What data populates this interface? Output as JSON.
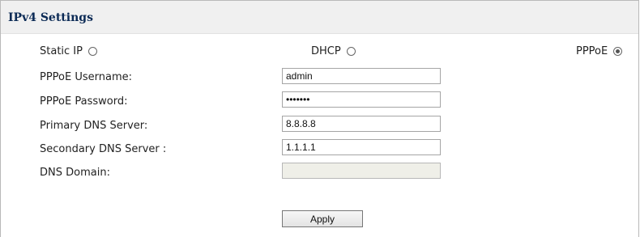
{
  "section": {
    "title": "IPv4 Settings"
  },
  "mode": {
    "options": [
      {
        "label": "Static IP",
        "checked": false
      },
      {
        "label": "DHCP",
        "checked": false
      },
      {
        "label": "PPPoE",
        "checked": true
      }
    ]
  },
  "fields": {
    "username": {
      "label": "PPPoE Username:",
      "value": "admin"
    },
    "password": {
      "label": "PPPoE Password:",
      "value": "admin12"
    },
    "primary_dns": {
      "label": "Primary DNS Server:",
      "value": "8.8.8.8"
    },
    "secondary_dns": {
      "label": "Secondary DNS Server :",
      "value": "1.1.1.1"
    },
    "dns_domain": {
      "label": "DNS Domain:",
      "value": ""
    }
  },
  "buttons": {
    "apply_label": "Apply"
  }
}
